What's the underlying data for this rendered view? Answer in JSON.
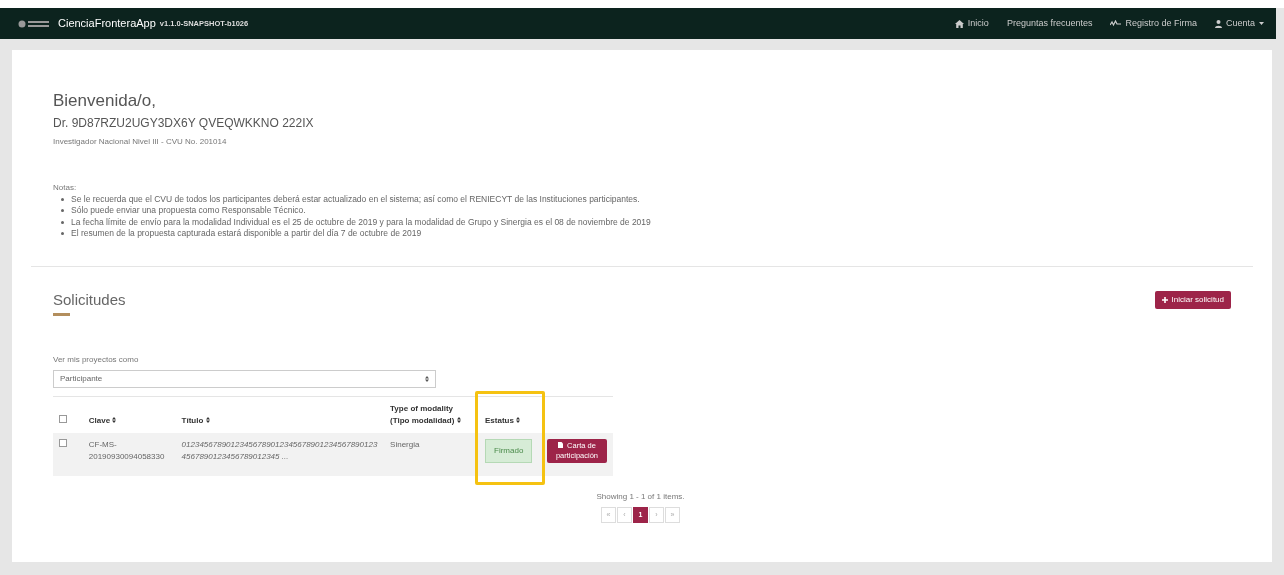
{
  "navbar": {
    "brand": "CienciaFronteraApp",
    "version": "v1.1.0-SNAPSHOT-b1026",
    "links": [
      {
        "kind": "home",
        "label": "Inicio"
      },
      {
        "kind": "plain",
        "label": "Preguntas frecuentes"
      },
      {
        "kind": "signature",
        "label": "Registro de Firma"
      },
      {
        "kind": "account",
        "label": "Cuenta",
        "dropdown": true
      }
    ]
  },
  "welcome": {
    "greeting": "Bienvenida/o,",
    "name": "Dr. 9D87RZU2UGY3DX6Y QVEQWKKNO 222IX",
    "subtitle": "Investigador Nacional Nivel III - CVU No. 201014"
  },
  "notes": {
    "heading": "Notas:",
    "items": [
      "Se le recuerda que el CVU de todos los participantes deberá estar actualizado en el sistema; así como el RENIECYT de las Instituciones participantes.",
      "Sólo puede enviar una propuesta como Responsable Técnico.",
      "La fecha límite de envío para la modalidad Individual es el 25 de octubre de 2019 y para la modalidad de Grupo y Sinergia es el 08 de noviembre de 2019",
      "El resumen de la propuesta capturada estará disponible a partir del día 7 de octubre de 2019"
    ]
  },
  "solicitudes": {
    "title": "Solicitudes",
    "new_button": "Iniciar solicitud",
    "filter_label": "Ver mis proyectos como",
    "filter_value": "Participante",
    "table": {
      "select_all_checked": false,
      "columns": [
        {
          "label": "Clave",
          "highlighted": false
        },
        {
          "label": "Título",
          "highlighted": false
        },
        {
          "label": "Type of modality (Tipo modalidad)",
          "highlighted": false
        },
        {
          "label": "Estatus",
          "highlighted": true
        }
      ],
      "rows": [
        {
          "checked": false,
          "clave": "CF-MS-20190930094058330",
          "titulo": "012345678901234567890123456789012345678901234567890123456789012345 ...",
          "modalidad": "Sinergia",
          "estatus": "Firmado",
          "action": "Carta de participación"
        }
      ]
    },
    "summary": "Showing 1 - 1 of 1 items.",
    "pagination": [
      {
        "label": "«",
        "selected": false
      },
      {
        "label": "‹",
        "selected": false
      },
      {
        "label": "1",
        "selected": true
      },
      {
        "label": "›",
        "selected": false
      },
      {
        "label": "»",
        "selected": false
      }
    ]
  }
}
